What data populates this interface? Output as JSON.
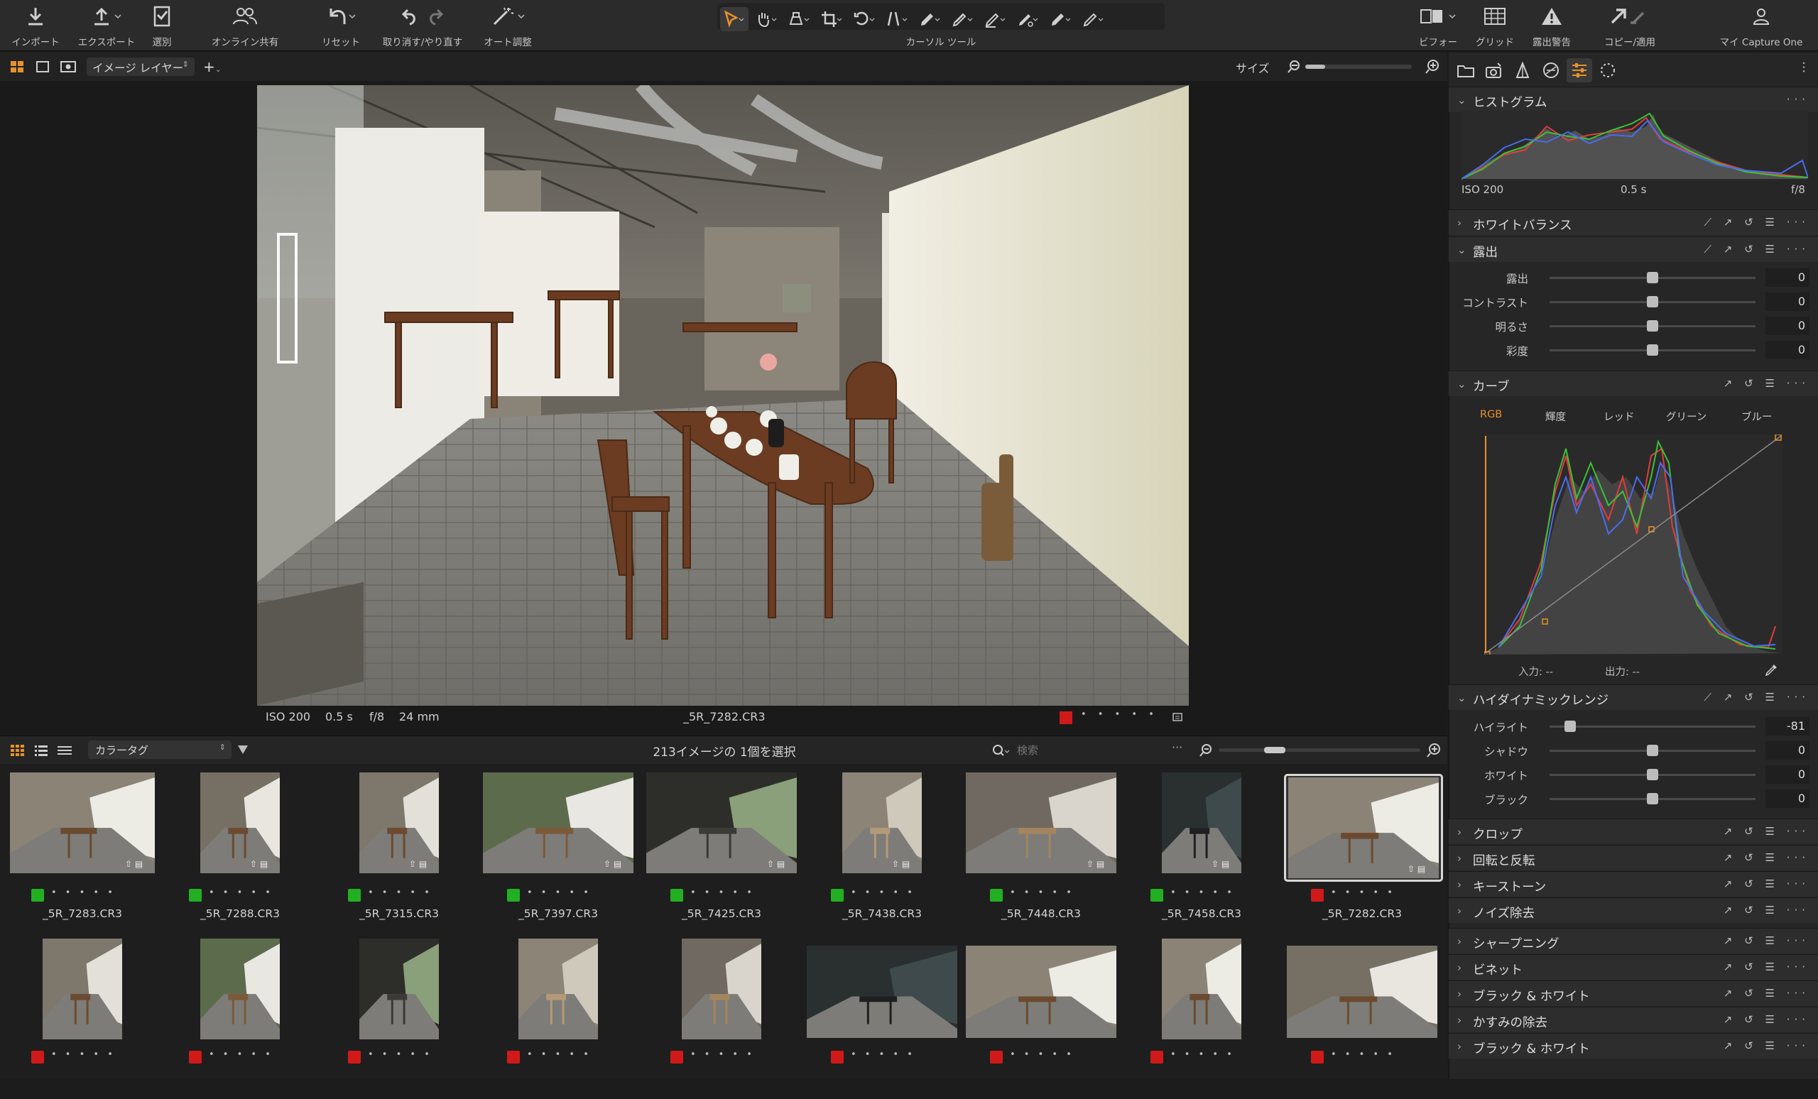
{
  "toolbar": {
    "import": "インポート",
    "export": "エクスポート",
    "select": "選別",
    "share": "オンライン共有",
    "reset": "リセット",
    "undo": "取り消す/やり直す",
    "auto": "オート調整",
    "cursor_tools": "カーソル ツール",
    "before": "ビフォー",
    "grid": "グリッド",
    "exposure_warning": "露出警告",
    "copy_apply": "コピー/適用",
    "account": "マイ Capture One"
  },
  "viewer": {
    "layer_select": "イメージ レイヤー",
    "size_label": "サイズ",
    "iso": "ISO 200",
    "shutter": "0.5 s",
    "aperture": "f/8",
    "focal": "24 mm",
    "filename": "_5R_7282.CR3"
  },
  "browser": {
    "sort_select": "カラータグ",
    "selection_status": "213イメージの 1個を選択",
    "search_placeholder": "検索",
    "row1": [
      {
        "name": "_5R_7283.CR3",
        "tag": "#22b022"
      },
      {
        "name": "_5R_7288.CR3",
        "tag": "#22b022"
      },
      {
        "name": "_5R_7315.CR3",
        "tag": "#22b022"
      },
      {
        "name": "_5R_7397.CR3",
        "tag": "#22b022"
      },
      {
        "name": "_5R_7425.CR3",
        "tag": "#22b022"
      },
      {
        "name": "_5R_7438.CR3",
        "tag": "#22b022"
      },
      {
        "name": "_5R_7448.CR3",
        "tag": "#22b022"
      },
      {
        "name": "_5R_7458.CR3",
        "tag": "#22b022"
      },
      {
        "name": "_5R_7282.CR3",
        "tag": "#d01a1a"
      }
    ],
    "row2_tag": "#d01a1a",
    "dots": "• • • • •"
  },
  "panel": {
    "histogram": {
      "title": "ヒストグラム",
      "iso": "ISO 200",
      "shutter": "0.5 s",
      "aperture": "f/8"
    },
    "white_balance": "ホワイトバランス",
    "exposure": {
      "title": "露出",
      "rows": [
        {
          "label": "露出",
          "value": "0",
          "level": 0.5
        },
        {
          "label": "コントラスト",
          "value": "0",
          "level": 0.5
        },
        {
          "label": "明るさ",
          "value": "0",
          "level": 0.5
        },
        {
          "label": "彩度",
          "value": "0",
          "level": 0.5
        }
      ]
    },
    "curve": {
      "title": "カーブ",
      "tabs": [
        "RGB",
        "輝度",
        "レッド",
        "グリーン",
        "ブルー"
      ],
      "input": "入力: --",
      "output": "出力: --"
    },
    "hdr": {
      "title": "ハイダイナミックレンジ",
      "rows": [
        {
          "label": "ハイライト",
          "value": "-81",
          "level": 0.1
        },
        {
          "label": "シャドウ",
          "value": "0",
          "level": 0.5
        },
        {
          "label": "ホワイト",
          "value": "0",
          "level": 0.5
        },
        {
          "label": "ブラック",
          "value": "0",
          "level": 0.5
        }
      ]
    },
    "sections": [
      "クロップ",
      "回転と反転",
      "キーストーン",
      "ノイズ除去",
      "シャープニング",
      "ビネット",
      "ブラック & ホワイト",
      "かすみの除去",
      "ブラック & ホワイト"
    ],
    "accent": "#e8922a"
  }
}
